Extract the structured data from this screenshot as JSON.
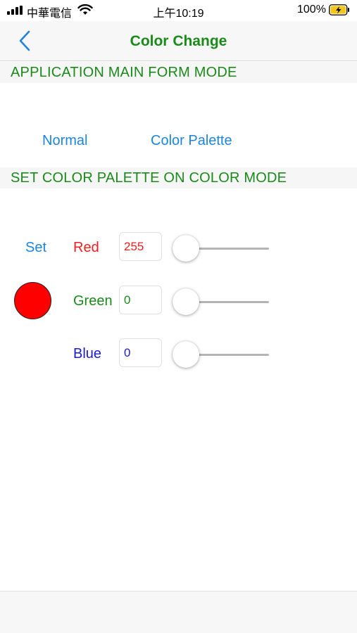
{
  "status_bar": {
    "carrier": "中華電信",
    "time": "上午10:19",
    "battery_percent": "100%"
  },
  "nav": {
    "title": "Color Change",
    "title_color": "#1a8a1a"
  },
  "sections": {
    "main_form_header": "APPLICATION MAIN FORM MODE",
    "palette_header": "SET COLOR PALETTE ON COLOR MODE"
  },
  "modes": {
    "normal_label": "Normal",
    "palette_label": "Color Palette"
  },
  "palette": {
    "set_label": "Set",
    "swatch_color": "#ff0000",
    "channels": {
      "red": {
        "label": "Red",
        "value": "255",
        "color": "#f01e1e",
        "slider_fraction": 0
      },
      "green": {
        "label": "Green",
        "value": "0",
        "color": "#1a8a1a",
        "slider_fraction": 0
      },
      "blue": {
        "label": "Blue",
        "value": "0",
        "color": "#1d1dd0",
        "slider_fraction": 0
      }
    }
  },
  "colors": {
    "accent": "#1f84e0",
    "header_text": "#1a8a1a"
  }
}
